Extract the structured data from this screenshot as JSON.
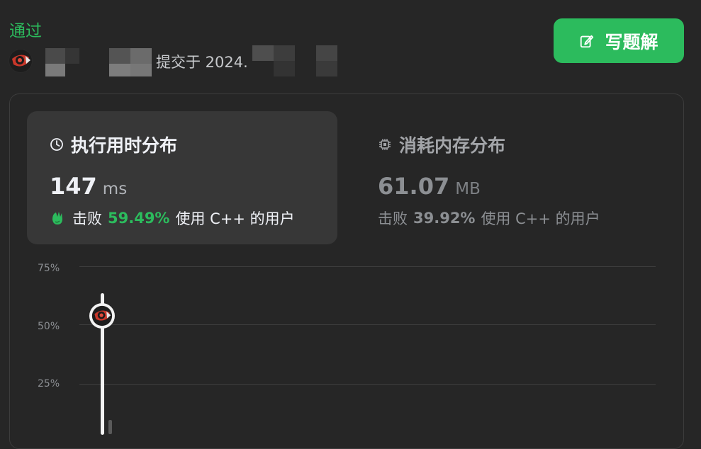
{
  "status": "通过",
  "submission": {
    "text": "提交于 2024."
  },
  "write_button": {
    "label": "写题解",
    "icon": "edit-icon"
  },
  "runtime": {
    "title": "执行用时分布",
    "value": "147",
    "unit": "ms",
    "beat_label": "击败",
    "percent": "59.49%",
    "suffix": "使用 C++ 的用户",
    "icon": "clock-icon"
  },
  "memory": {
    "title": "消耗内存分布",
    "value": "61.07",
    "unit": "MB",
    "beat_label": "击败",
    "percent": "39.92%",
    "suffix": "使用 C++ 的用户",
    "icon": "chip-icon"
  },
  "colors": {
    "accent": "#2cbb5d",
    "panel": "#373737",
    "background": "#262626"
  },
  "chart_data": {
    "type": "bar",
    "y_ticks": [
      "75%",
      "50%",
      "25%"
    ],
    "ylim": [
      0,
      75
    ],
    "marker_percent": 55
  }
}
